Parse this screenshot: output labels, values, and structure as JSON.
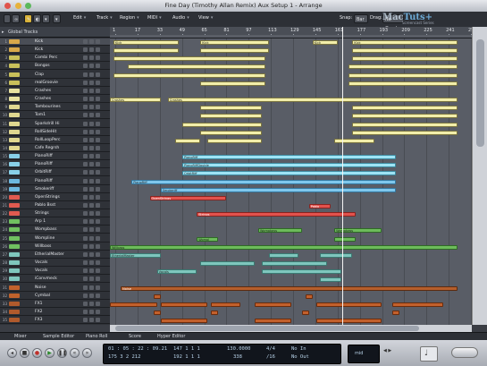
{
  "window": {
    "title": "Fine Day (Timothy Allan Remix) Aux Setup 1 - Arrange"
  },
  "toolbar": {
    "menus": [
      "Edit",
      "Track",
      "Region",
      "MIDI",
      "Audio",
      "View"
    ],
    "snap_label": "Snap:",
    "snap_value": "Bar",
    "drag_label": "Drag:",
    "drag_value": "No Overlap"
  },
  "watermark": {
    "text_prefix": "Mac",
    "text_suffix": "Tuts+",
    "sub": "Screencast Series"
  },
  "global_tracks_label": "Global Tracks",
  "ruler": {
    "numbers": [
      "1",
      "17",
      "33",
      "49",
      "65",
      "81",
      "97",
      "113",
      "129",
      "145",
      "161",
      "177",
      "193",
      "209",
      "225",
      "241",
      "257"
    ]
  },
  "tracks": [
    {
      "num": "1",
      "name": "Kick",
      "color": "#d8a84a"
    },
    {
      "num": "2",
      "name": "Kick",
      "color": "#d8a84a"
    },
    {
      "num": "3",
      "name": "Combi Perc",
      "color": "#c9c05a"
    },
    {
      "num": "4",
      "name": "Bongos",
      "color": "#c9c05a"
    },
    {
      "num": "5",
      "name": "Clap",
      "color": "#c9c05a"
    },
    {
      "num": "6",
      "name": "realGroovie",
      "color": "#c9c05a"
    },
    {
      "num": "7",
      "name": "Crashes",
      "color": "#e8e2a0"
    },
    {
      "num": "8",
      "name": "Crashes",
      "color": "#e8e2a0"
    },
    {
      "num": "9",
      "name": "Tambourines",
      "color": "#e0d890"
    },
    {
      "num": "10",
      "name": "Tom1",
      "color": "#e0d890"
    },
    {
      "num": "11",
      "name": "Sparkdrill Hi",
      "color": "#e0d890"
    },
    {
      "num": "12",
      "name": "RollSideHit",
      "color": "#e0d890"
    },
    {
      "num": "13",
      "name": "RollLoopPerc",
      "color": "#e0d890"
    },
    {
      "num": "14",
      "name": "Cafe Regrsh",
      "color": "#e0d890"
    },
    {
      "num": "15",
      "name": "PianoRiff",
      "color": "#88d0e8"
    },
    {
      "num": "16",
      "name": "PianoRiff",
      "color": "#88d0e8"
    },
    {
      "num": "17",
      "name": "OrbitRiff",
      "color": "#88d0e8"
    },
    {
      "num": "18",
      "name": "PianoRiff",
      "color": "#6cb8e0"
    },
    {
      "num": "19",
      "name": "Smokeriff",
      "color": "#6cb8e0"
    },
    {
      "num": "20",
      "name": "OpenStrings",
      "color": "#e05a50"
    },
    {
      "num": "21",
      "name": "Pablo Bsst",
      "color": "#e05a50"
    },
    {
      "num": "22",
      "name": "Strings",
      "color": "#e05a50"
    },
    {
      "num": "23",
      "name": "Arp 1",
      "color": "#70c060"
    },
    {
      "num": "24",
      "name": "Wompbass",
      "color": "#70c060"
    },
    {
      "num": "25",
      "name": "Wompline",
      "color": "#70c060"
    },
    {
      "num": "26",
      "name": "Willbass",
      "color": "#70c060"
    },
    {
      "num": "27",
      "name": "EtherialMaster",
      "color": "#7fc6bd"
    },
    {
      "num": "28",
      "name": "Vocals",
      "color": "#7fc6bd"
    },
    {
      "num": "29",
      "name": "Vocals",
      "color": "#7fc6bd"
    },
    {
      "num": "30",
      "name": "iConvmeck",
      "color": "#7fc6bd"
    },
    {
      "num": "31",
      "name": "Noise",
      "color": "#c0622c"
    },
    {
      "num": "32",
      "name": "Cymbal",
      "color": "#c0622c"
    },
    {
      "num": "33",
      "name": "FX1",
      "color": "#b05a2c"
    },
    {
      "num": "34",
      "name": "FX2",
      "color": "#b05a2c"
    },
    {
      "num": "35",
      "name": "FX3",
      "color": "#b05a2c"
    }
  ],
  "regions": [
    {
      "row": 0,
      "start": 0.01,
      "end": 0.19,
      "color": "yellow",
      "label": "Kick"
    },
    {
      "row": 0,
      "start": 0.25,
      "end": 0.44,
      "color": "yellow",
      "label": "Kick"
    },
    {
      "row": 0,
      "start": 0.56,
      "end": 0.63,
      "color": "yellow",
      "label": "Kick"
    },
    {
      "row": 0,
      "start": 0.67,
      "end": 0.96,
      "color": "yellow",
      "label": "Kick"
    },
    {
      "row": 1,
      "start": 0.01,
      "end": 0.19,
      "color": "yellow",
      "label": ""
    },
    {
      "row": 1,
      "start": 0.25,
      "end": 0.44,
      "color": "yellow",
      "label": ""
    },
    {
      "row": 1,
      "start": 0.67,
      "end": 0.96,
      "color": "yellow",
      "label": ""
    },
    {
      "row": 2,
      "start": 0.01,
      "end": 0.43,
      "color": "yellow",
      "label": ""
    },
    {
      "row": 2,
      "start": 0.67,
      "end": 0.96,
      "color": "yellow",
      "label": ""
    },
    {
      "row": 3,
      "start": 0.05,
      "end": 0.43,
      "color": "yellow",
      "label": ""
    },
    {
      "row": 3,
      "start": 0.66,
      "end": 0.96,
      "color": "yellow",
      "label": ""
    },
    {
      "row": 4,
      "start": 0.01,
      "end": 0.43,
      "color": "yellow",
      "label": ""
    },
    {
      "row": 4,
      "start": 0.66,
      "end": 0.96,
      "color": "yellow",
      "label": ""
    },
    {
      "row": 5,
      "start": 0.25,
      "end": 0.43,
      "color": "yellow",
      "label": ""
    },
    {
      "row": 5,
      "start": 0.66,
      "end": 0.96,
      "color": "yellow",
      "label": ""
    },
    {
      "row": 7,
      "start": 0.0,
      "end": 0.14,
      "color": "yellow",
      "label": "Crashes"
    },
    {
      "row": 7,
      "start": 0.16,
      "end": 0.96,
      "color": "yellow",
      "label": "Crashes"
    },
    {
      "row": 8,
      "start": 0.25,
      "end": 0.42,
      "color": "yellow",
      "label": ""
    },
    {
      "row": 8,
      "start": 0.67,
      "end": 0.96,
      "color": "yellow",
      "label": ""
    },
    {
      "row": 9,
      "start": 0.25,
      "end": 0.42,
      "color": "yellow",
      "label": ""
    },
    {
      "row": 9,
      "start": 0.67,
      "end": 0.96,
      "color": "yellow",
      "label": ""
    },
    {
      "row": 10,
      "start": 0.2,
      "end": 0.42,
      "color": "yellow",
      "label": ""
    },
    {
      "row": 10,
      "start": 0.67,
      "end": 0.96,
      "color": "yellow",
      "label": ""
    },
    {
      "row": 11,
      "start": 0.25,
      "end": 0.42,
      "color": "yellow",
      "label": ""
    },
    {
      "row": 11,
      "start": 0.67,
      "end": 0.96,
      "color": "yellow",
      "label": ""
    },
    {
      "row": 12,
      "start": 0.18,
      "end": 0.25,
      "color": "yellow",
      "label": ""
    },
    {
      "row": 12,
      "start": 0.27,
      "end": 0.42,
      "color": "yellow",
      "label": ""
    },
    {
      "row": 12,
      "start": 0.62,
      "end": 0.73,
      "color": "yellow",
      "label": ""
    },
    {
      "row": 14,
      "start": 0.2,
      "end": 0.79,
      "color": "cyan",
      "label": "PianoRiff"
    },
    {
      "row": 15,
      "start": 0.2,
      "end": 0.79,
      "color": "cyan",
      "label": "PianoRiffDouble"
    },
    {
      "row": 16,
      "start": 0.2,
      "end": 0.79,
      "color": "cyan",
      "label": "OrbitRiff"
    },
    {
      "row": 17,
      "start": 0.06,
      "end": 0.79,
      "color": "blue",
      "label": "PianoRiff"
    },
    {
      "row": 18,
      "start": 0.14,
      "end": 0.79,
      "color": "blue",
      "label": "Smokeriff"
    },
    {
      "row": 19,
      "start": 0.11,
      "end": 0.32,
      "color": "red",
      "label": "OpenStrings"
    },
    {
      "row": 20,
      "start": 0.55,
      "end": 0.61,
      "color": "red",
      "label": "Pablo"
    },
    {
      "row": 21,
      "start": 0.24,
      "end": 0.68,
      "color": "red",
      "label": "Strings"
    },
    {
      "row": 23,
      "start": 0.41,
      "end": 0.53,
      "color": "green",
      "label": "Wompbass"
    },
    {
      "row": 23,
      "start": 0.62,
      "end": 0.75,
      "color": "green",
      "label": "Wompbass"
    },
    {
      "row": 24,
      "start": 0.24,
      "end": 0.3,
      "color": "green",
      "label": "Wompl"
    },
    {
      "row": 24,
      "start": 0.62,
      "end": 0.68,
      "color": "green",
      "label": ""
    },
    {
      "row": 25,
      "start": 0.0,
      "end": 0.96,
      "color": "green",
      "label": "Willbass"
    },
    {
      "row": 26,
      "start": 0.0,
      "end": 0.14,
      "color": "teal",
      "label": "EtherialMaster"
    },
    {
      "row": 26,
      "start": 0.44,
      "end": 0.52,
      "color": "teal",
      "label": ""
    },
    {
      "row": 26,
      "start": 0.58,
      "end": 0.67,
      "color": "teal",
      "label": ""
    },
    {
      "row": 27,
      "start": 0.25,
      "end": 0.4,
      "color": "teal",
      "label": ""
    },
    {
      "row": 27,
      "start": 0.42,
      "end": 0.6,
      "color": "teal",
      "label": ""
    },
    {
      "row": 28,
      "start": 0.13,
      "end": 0.24,
      "color": "teal",
      "label": "Vocals"
    },
    {
      "row": 28,
      "start": 0.42,
      "end": 0.64,
      "color": "teal",
      "label": ""
    },
    {
      "row": 29,
      "start": 0.58,
      "end": 0.64,
      "color": "teal",
      "label": ""
    },
    {
      "row": 30,
      "start": 0.03,
      "end": 0.96,
      "color": "brown",
      "label": "Noise"
    },
    {
      "row": 31,
      "start": 0.12,
      "end": 0.14,
      "color": "orange",
      "label": ""
    },
    {
      "row": 31,
      "start": 0.54,
      "end": 0.56,
      "color": "orange",
      "label": ""
    },
    {
      "row": 32,
      "start": 0.0,
      "end": 0.13,
      "color": "orange",
      "label": ""
    },
    {
      "row": 32,
      "start": 0.14,
      "end": 0.27,
      "color": "orange",
      "label": ""
    },
    {
      "row": 32,
      "start": 0.28,
      "end": 0.36,
      "color": "orange",
      "label": ""
    },
    {
      "row": 32,
      "start": 0.4,
      "end": 0.5,
      "color": "orange",
      "label": ""
    },
    {
      "row": 32,
      "start": 0.57,
      "end": 0.75,
      "color": "orange",
      "label": ""
    },
    {
      "row": 32,
      "start": 0.78,
      "end": 0.92,
      "color": "orange",
      "label": ""
    },
    {
      "row": 33,
      "start": 0.12,
      "end": 0.14,
      "color": "orange",
      "label": ""
    },
    {
      "row": 33,
      "start": 0.28,
      "end": 0.3,
      "color": "orange",
      "label": ""
    },
    {
      "row": 33,
      "start": 0.53,
      "end": 0.55,
      "color": "orange",
      "label": ""
    },
    {
      "row": 33,
      "start": 0.78,
      "end": 0.8,
      "color": "orange",
      "label": ""
    },
    {
      "row": 34,
      "start": 0.14,
      "end": 0.27,
      "color": "orange",
      "label": ""
    },
    {
      "row": 34,
      "start": 0.4,
      "end": 0.5,
      "color": "orange",
      "label": ""
    },
    {
      "row": 34,
      "start": 0.57,
      "end": 0.75,
      "color": "orange",
      "label": ""
    }
  ],
  "editor_tabs": [
    "Mixer",
    "Sample Editor",
    "Piano Roll",
    "Score",
    "Hyper Editor"
  ],
  "transport": {
    "smpte": "01 : 05 : 22 : 09.21",
    "bars": "175 3 2 212",
    "pos1": "147 1 1 1",
    "pos2": "192 1 1 1",
    "tempo": "130.0000",
    "division": "338",
    "sig": "4/4",
    "div2": "/16",
    "in": "No In",
    "out": "No Out",
    "cpu_label": "mid"
  }
}
